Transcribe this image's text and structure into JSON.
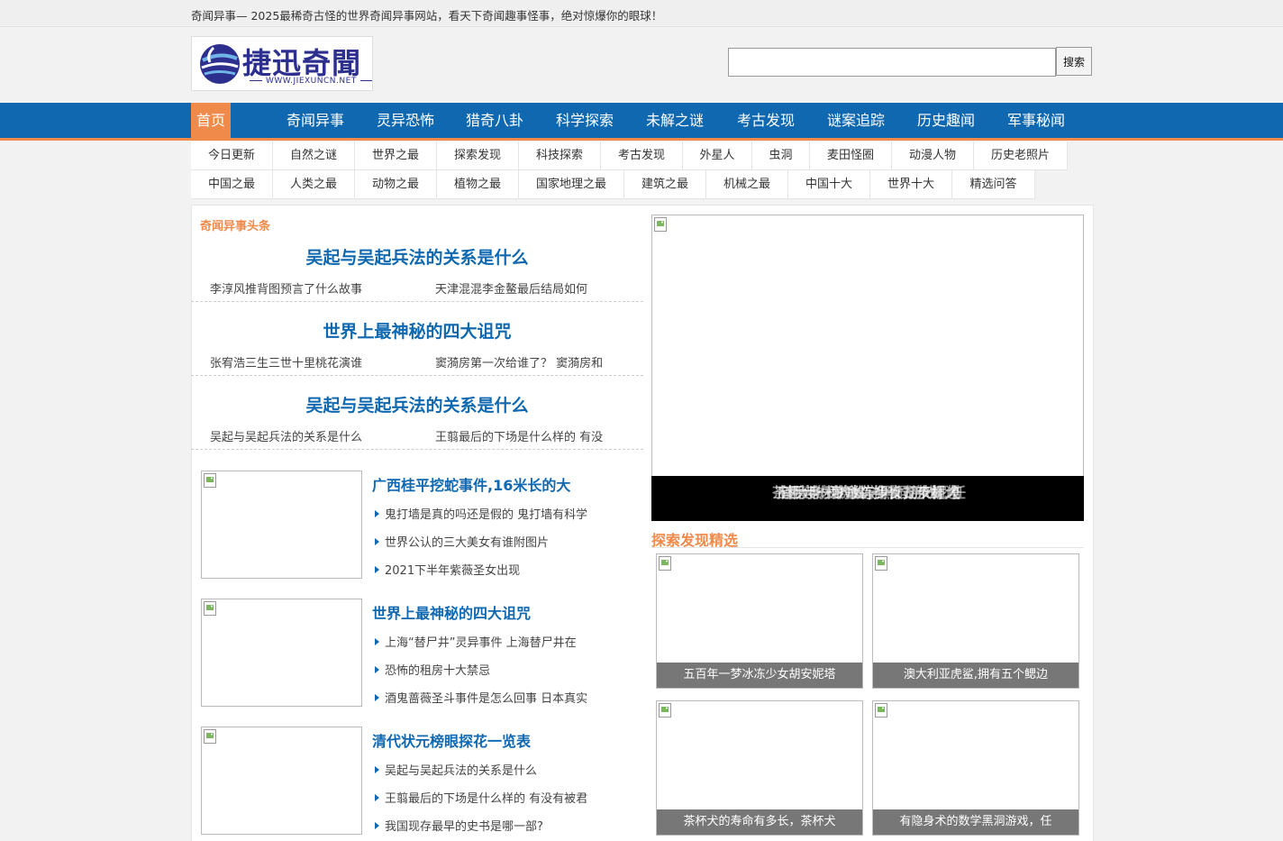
{
  "topbar": {
    "tagline": "奇闻异事— 2025最稀奇古怪的世界奇闻异事网站，看天下奇闻趣事怪事，绝对惊爆你的眼球！"
  },
  "header": {
    "logo_text": "捷迅奇聞",
    "logo_url": "WWW.JIEXUNCN.NET",
    "search_placeholder": "",
    "search_button": "搜索"
  },
  "mainnav": [
    {
      "label": "首页",
      "active": true
    },
    {
      "label": "奇闻异事"
    },
    {
      "label": "灵异恐怖"
    },
    {
      "label": "猎奇八卦"
    },
    {
      "label": "科学探索"
    },
    {
      "label": "未解之谜"
    },
    {
      "label": "考古发现"
    },
    {
      "label": "谜案追踪"
    },
    {
      "label": "历史趣闻"
    },
    {
      "label": "军事秘闻"
    }
  ],
  "subnav": {
    "row1": [
      "今日更新",
      "自然之谜",
      "世界之最",
      "探索发现",
      "科技探索",
      "考古发现",
      "外星人",
      "虫洞",
      "麦田怪圈",
      "动漫人物",
      "历史老照片"
    ],
    "row2": [
      "中国之最",
      "人类之最",
      "动物之最",
      "植物之最",
      "国家地理之最",
      "建筑之最",
      "机械之最",
      "中国十大",
      "世界十大",
      "精选问答"
    ]
  },
  "headlines": {
    "section_title": "奇闻异事头条",
    "items": [
      {
        "title": "吴起与吴起兵法的关系是什么",
        "left": "李淳风推背图预言了什么故事",
        "right": "天津混混李金鳌最后结局如何"
      },
      {
        "title": "世界上最神秘的四大诅咒",
        "left": "张宥浩三生三世十里桃花演谁",
        "right": "窦漪房第一次给谁了？ 窦漪房和"
      },
      {
        "title": "吴起与吴起兵法的关系是什么",
        "left": "吴起与吴起兵法的关系是什么",
        "right": "王翦最后的下场是什么样的 有没"
      }
    ]
  },
  "articles": [
    {
      "title": "广西桂平挖蛇事件,16米长的大",
      "items": [
        "鬼打墙是真的吗还是假的 鬼打墙有科学",
        "世界公认的三大美女有谁附图片",
        "2021下半年紫薇圣女出现"
      ]
    },
    {
      "title": "世界上最神秘的四大诅咒",
      "items": [
        "上海“替尸井”灵异事件 上海替尸井在",
        "恐怖的租房十大禁忌",
        "酒鬼蔷薇圣斗事件是怎么回事 日本真实"
      ]
    },
    {
      "title": "清代状元榜眼探花一览表",
      "items": [
        "吴起与吴起兵法的关系是什么",
        "王翦最后的下场是什么样的 有没有被君",
        "我国现存最早的史书是哪一部?"
      ]
    }
  ],
  "slider": {
    "captions": [
      "五百年一梦冰冻少女胡安妮塔",
      "澳大利亚虎鲨,拥有五个鳃边",
      "茶杯犬的寿命有多长，茶杯犬",
      "有隐身术的数学黑洞游戏，任"
    ]
  },
  "explore": {
    "section_title": "探索发现精选",
    "tiles": [
      "五百年一梦冰冻少女胡安妮塔",
      "澳大利亚虎鲨,拥有五个鳃边",
      "茶杯犬的寿命有多长，茶杯犬",
      "有隐身术的数学黑洞游戏，任"
    ]
  },
  "colors": {
    "brand_blue": "#0f68b0",
    "accent_orange": "#f08a4b",
    "logo_navy": "#2d2f8e"
  }
}
